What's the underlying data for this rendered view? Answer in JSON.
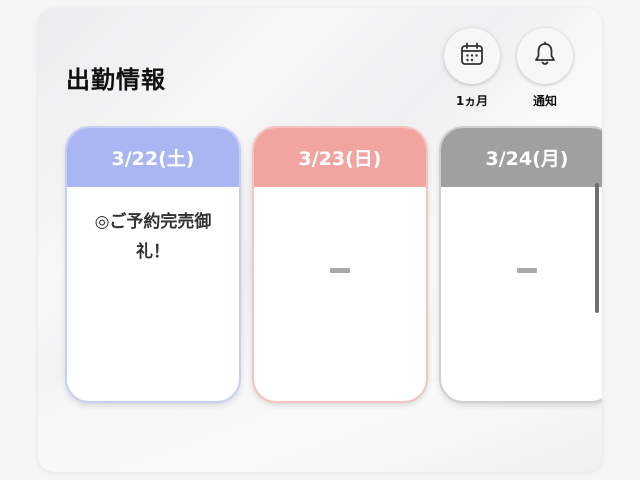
{
  "header": {
    "title": "出勤情報",
    "buttons": [
      {
        "icon": "calendar-icon",
        "label": "1ヵ月"
      },
      {
        "icon": "bell-icon",
        "label": "通知"
      }
    ]
  },
  "schedule": [
    {
      "date": "3/22(土)",
      "text": "◎ご予約完売御礼！",
      "color": "#a9b6f2",
      "border": "#c7cff5",
      "empty": false
    },
    {
      "date": "3/23(日)",
      "text": "",
      "color": "#f2a5a0",
      "border": "#f3c4c0",
      "empty": true
    },
    {
      "date": "3/24(月)",
      "text": "",
      "color": "#a0a0a0",
      "border": "#cfcfcf",
      "empty": true
    }
  ],
  "colors": {
    "saturday": "#a9b6f2",
    "sunday": "#f2a5a0",
    "weekday": "#a0a0a0",
    "dash": "#a9a9a9"
  }
}
